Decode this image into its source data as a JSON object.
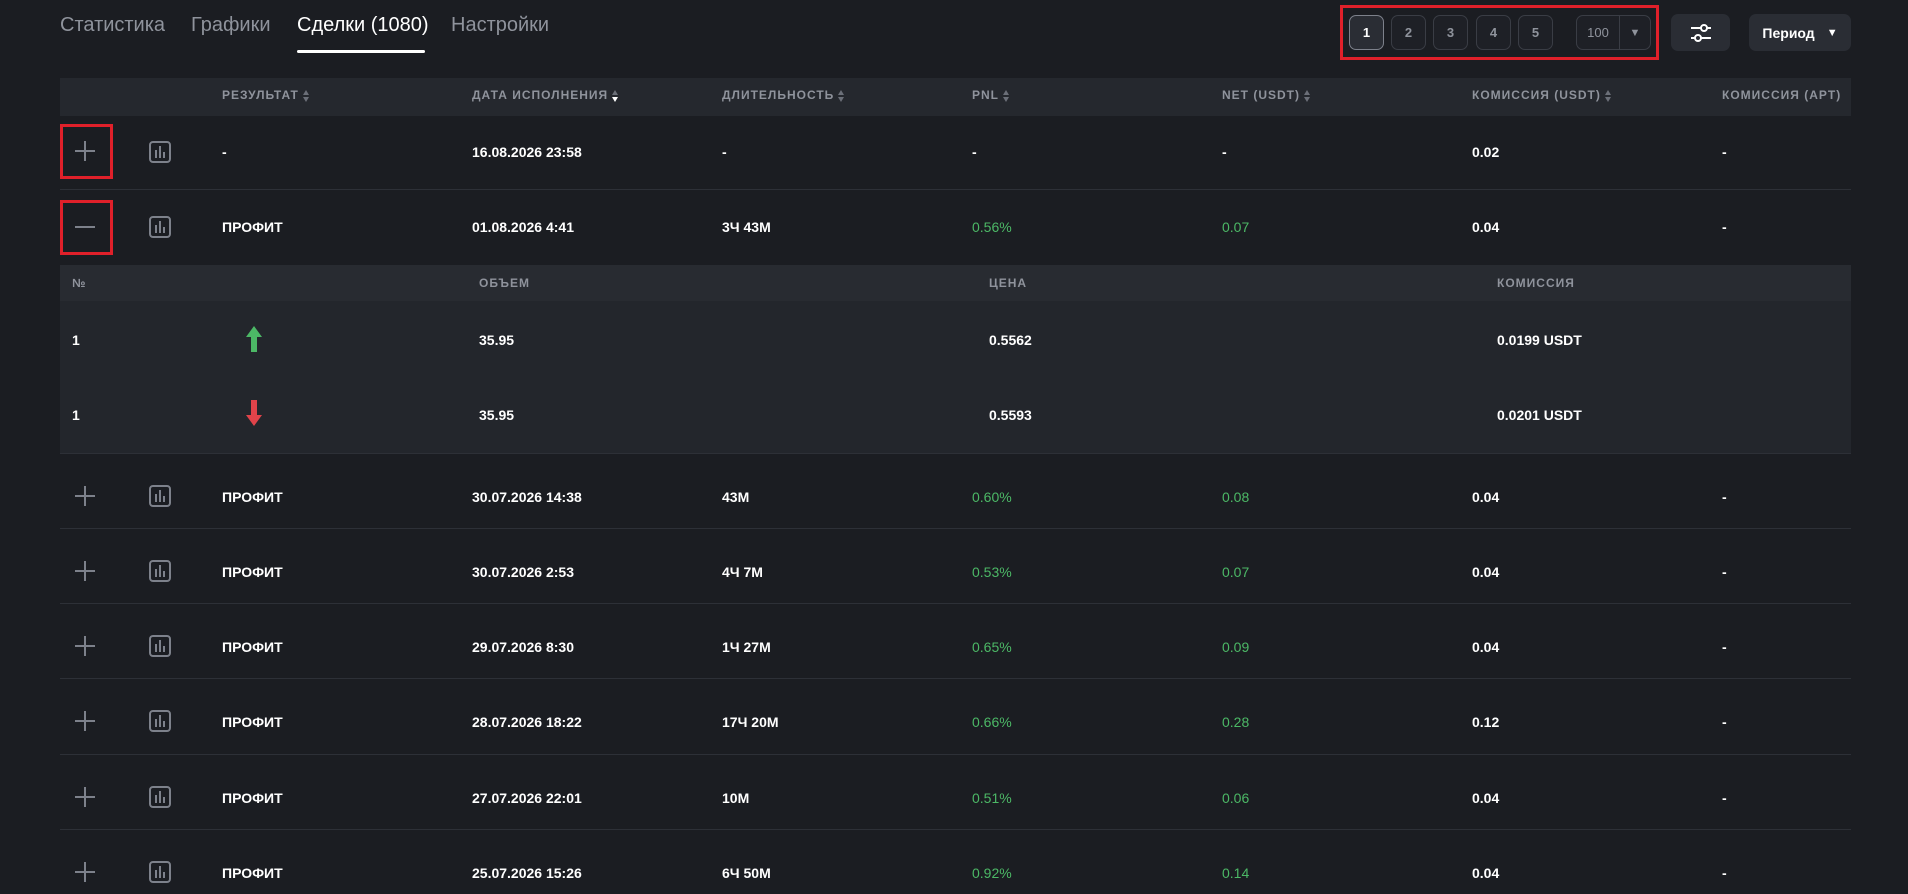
{
  "tabs": [
    {
      "label": "Статистика"
    },
    {
      "label": "Графики"
    },
    {
      "label": "Сделки (1080)"
    },
    {
      "label": "Настройки"
    }
  ],
  "pagination": {
    "pages": [
      "1",
      "2",
      "3",
      "4",
      "5"
    ],
    "active_page": "1",
    "page_size": "100"
  },
  "period": {
    "label": "Период"
  },
  "columns": [
    "РЕЗУЛЬТАТ",
    "ДАТА ИСПОЛНЕНИЯ",
    "ДЛИТЕЛЬНОСТЬ",
    "PNL",
    "NET (USDT)",
    "КОМИССИЯ (USDT)",
    "КОМИССИЯ (APT)"
  ],
  "rows": [
    {
      "result": "-",
      "date": "16.08.2026 23:58",
      "duration": "-",
      "pnl": "-",
      "net": "-",
      "fee_usdt": "0.02",
      "fee_apt": "-"
    },
    {
      "result": "ПРОФИТ",
      "date": "01.08.2026 4:41",
      "duration": "3Ч 43М",
      "pnl": "0.56%",
      "net": "0.07",
      "fee_usdt": "0.04",
      "fee_apt": "-"
    },
    {
      "result": "ПРОФИТ",
      "date": "30.07.2026 14:38",
      "duration": "43М",
      "pnl": "0.60%",
      "net": "0.08",
      "fee_usdt": "0.04",
      "fee_apt": "-"
    },
    {
      "result": "ПРОФИТ",
      "date": "30.07.2026 2:53",
      "duration": "4Ч 7М",
      "pnl": "0.53%",
      "net": "0.07",
      "fee_usdt": "0.04",
      "fee_apt": "-"
    },
    {
      "result": "ПРОФИТ",
      "date": "29.07.2026 8:30",
      "duration": "1Ч 27М",
      "pnl": "0.65%",
      "net": "0.09",
      "fee_usdt": "0.04",
      "fee_apt": "-"
    },
    {
      "result": "ПРОФИТ",
      "date": "28.07.2026 18:22",
      "duration": "17Ч 20М",
      "pnl": "0.66%",
      "net": "0.28",
      "fee_usdt": "0.12",
      "fee_apt": "-"
    },
    {
      "result": "ПРОФИТ",
      "date": "27.07.2026 22:01",
      "duration": "10М",
      "pnl": "0.51%",
      "net": "0.06",
      "fee_usdt": "0.04",
      "fee_apt": "-"
    },
    {
      "result": "ПРОФИТ",
      "date": "25.07.2026 15:26",
      "duration": "6Ч 50М",
      "pnl": "0.92%",
      "net": "0.14",
      "fee_usdt": "0.04",
      "fee_apt": "-"
    }
  ],
  "sub_table": {
    "columns": [
      "№",
      "ОБЪЕМ",
      "ЦЕНА",
      "КОМИССИЯ"
    ],
    "rows": [
      {
        "num": "1",
        "direction": "up-arrow-icon",
        "volume": "35.95",
        "price": "0.5562",
        "fee": "0.0199 USDT"
      },
      {
        "num": "1",
        "direction": "down-arrow-icon",
        "volume": "35.95",
        "price": "0.5593",
        "fee": "0.0201 USDT"
      }
    ]
  },
  "colors": {
    "background": "#1b1d22",
    "profit_green": "#4cb866",
    "buy_arrow": "#4cb866",
    "sell_arrow": "#e0434a",
    "highlight": "#e0202a"
  },
  "icons": [
    "plus-icon",
    "minus-icon",
    "chart-icon",
    "sliders-icon",
    "caret-down-icon"
  ]
}
